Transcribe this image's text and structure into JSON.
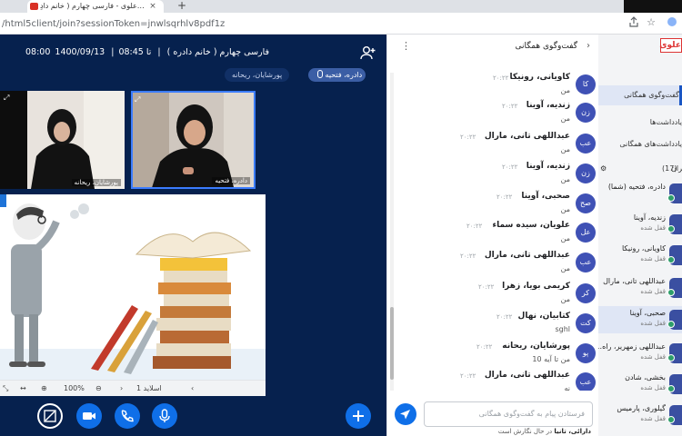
{
  "browser": {
    "tab_title": "علوی - فارسی چهارم ( خانم دادِ…",
    "tab_close": "×",
    "new_tab": "+",
    "url_path": "/html5client/join?sessionToken=jnwlsqrhlv8pdf1z"
  },
  "meeting": {
    "session_title": "فارسی چهارم ( خانم دادره )",
    "date": "1400/09/13",
    "time_range": "08:00 تا 08:45",
    "separator": "|",
    "active_speaker": "دادره، فتحیه",
    "other_speaker": "پورشایان، ریحانه"
  },
  "videos": [
    {
      "name": "پورشایان، ریحانه"
    },
    {
      "name": "دادره، فتحیه"
    }
  ],
  "presentation": {
    "slide_label": "اسلاید 1",
    "zoom": "100%"
  },
  "chat": {
    "title": "گفت‌وگوی همگانی",
    "input_placeholder": "فرستادن پیام به گفت‌وگوی همگانی",
    "typing_name": "دارائی، تانیا",
    "typing_suffix": "در حال نگارش است",
    "messages": [
      {
        "initials": "کا",
        "name": "کاویانی، رونیکا",
        "time": "۲۰:۲۲",
        "text": "من"
      },
      {
        "initials": "زن",
        "name": "زندیه، آوینا",
        "time": "۲۰:۲۲",
        "text": "من"
      },
      {
        "initials": "عب",
        "name": "عبداللهی تانی، مارال",
        "time": "۲۰:۲۲",
        "text": "من"
      },
      {
        "initials": "زن",
        "name": "زندیه، آوینا",
        "time": "۲۰:۲۲",
        "text": "من"
      },
      {
        "initials": "صح",
        "name": "صحبی، آوینا",
        "time": "۲۰:۲۲",
        "text": "من"
      },
      {
        "initials": "عل",
        "name": "علویان، سیده سماء",
        "time": "۲۰:۲۲",
        "text": "من"
      },
      {
        "initials": "عب",
        "name": "عبداللهی تانی، مارال",
        "time": "۲۰:۲۲",
        "text": "من"
      },
      {
        "initials": "کر",
        "name": "کریمی بویا، زهرا",
        "time": "۲۰:۲۲",
        "text": "من"
      },
      {
        "initials": "کت",
        "name": "کتابیان، نهال",
        "time": "۲۰:۲۲",
        "text": "sghl"
      },
      {
        "initials": "پو",
        "name": "پورشایان، ریحانه",
        "time": "۲۰:۲۲",
        "text": "من تا آیه 10"
      },
      {
        "initials": "عب",
        "name": "عبداللهی تانی، مارال",
        "time": "۲۰:۲۲",
        "text": "نه"
      }
    ]
  },
  "sidebar": {
    "brand": "علوی",
    "public_chat": "گفت‌وگوی همگانی",
    "notes_heading": "یادداشت‌ها",
    "shared_notes": "یادداشت‌های همگانی",
    "users_heading": "کاربران",
    "users_count": "(17)",
    "users": [
      {
        "name": "دادره، فتحیه (شما)",
        "status": ""
      },
      {
        "name": "زندیه، آوینا",
        "status": "قفل شده"
      },
      {
        "name": "کاویانی، رونیکا",
        "status": "قفل شده"
      },
      {
        "name": "عبداللهی تانی، مارال",
        "status": "قفل شده"
      },
      {
        "name": "صحبی، آوینا",
        "status": "قفل شده"
      },
      {
        "name": "عبداللهی زمهریر، راه…",
        "status": "قفل شده"
      },
      {
        "name": "بخشی، شادن",
        "status": "قفل شده"
      },
      {
        "name": "گیلوری، پارمیس",
        "status": "قفل شده"
      }
    ]
  }
}
